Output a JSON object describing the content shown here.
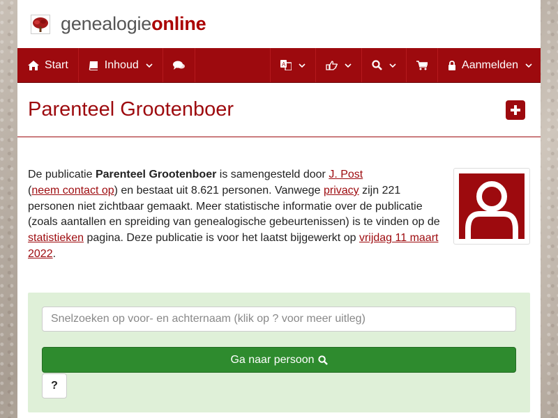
{
  "brand": {
    "part1": "genealogie",
    "part2": "online"
  },
  "nav": {
    "start": "Start",
    "inhoud": "Inhoud",
    "aanmelden": "Aanmelden"
  },
  "page": {
    "title": "Parenteel Grootenboer"
  },
  "intro": {
    "t1": "De publicatie ",
    "pub_name": "Parenteel Grootenboer",
    "t2": " is samengesteld door ",
    "author_link": "J. Post",
    "t3": " (",
    "contact_link": "neem contact op",
    "t4": ") en bestaat uit 8.621 personen. Vanwege ",
    "privacy_link": "privacy",
    "t5": " zijn 221 personen niet zichtbaar gemaakt. Meer statistische informatie over de publicatie (zoals aantallen en spreiding van genealogische gebeurtenissen) is te vinden op de ",
    "stats_link": "statistieken",
    "t6": " pagina. Deze publicatie is voor het laatst bijgewerkt op ",
    "date_link": "vrijdag 11 maart 2022",
    "t7": "."
  },
  "search": {
    "placeholder": "Snelzoeken op voor- en achternaam (klik op ? voor meer uitleg)",
    "go_label": "Ga naar persoon",
    "help_label": "?"
  },
  "icons": {
    "logo": "tree-logo-icon",
    "start": "home-icon",
    "inhoud": "book-icon",
    "chat": "comments-icon",
    "language": "language-icon",
    "share": "share-icon",
    "search": "search-icon",
    "cart": "cart-icon",
    "lock": "lock-icon",
    "plus": "plus-square-icon",
    "avatar": "user-avatar-icon"
  },
  "colors": {
    "brand_red": "#9d0a0e",
    "panel_green": "#dff0d8",
    "button_green": "#2e8b2e"
  }
}
